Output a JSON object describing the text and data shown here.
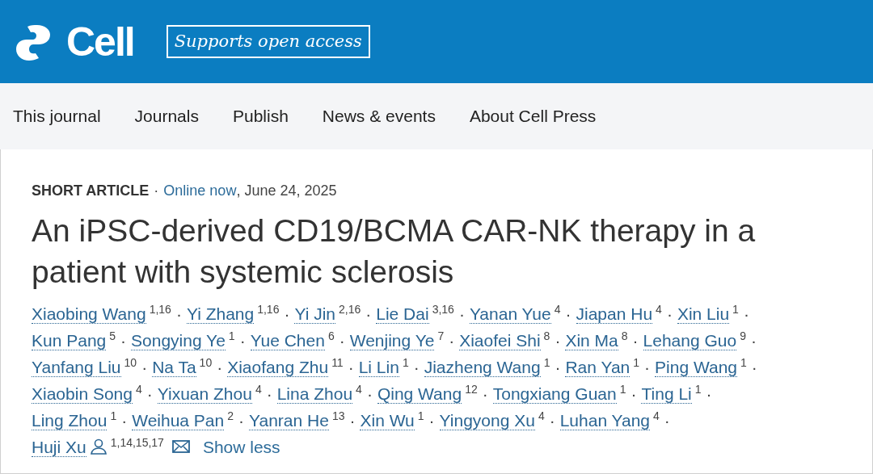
{
  "header": {
    "logo_text": "Cell",
    "badge": "Supports open access"
  },
  "nav": [
    "This journal",
    "Journals",
    "Publish",
    "News & events",
    "About Cell Press"
  ],
  "article": {
    "type": "SHORT ARTICLE",
    "meta_sep": "·",
    "status_link": "Online now",
    "date": ", June 24, 2025",
    "title": "An iPSC-derived CD19/BCMA CAR-NK therapy in a patient with systemic sclerosis",
    "author_lines": [
      [
        {
          "name": "Xiaobing Wang",
          "aff": "1,16",
          "sep": "·"
        },
        {
          "name": "Yi Zhang",
          "aff": "1,16",
          "sep": "·"
        },
        {
          "name": "Yi Jin",
          "aff": "2,16",
          "sep": "·"
        },
        {
          "name": "Lie Dai",
          "aff": "3,16",
          "sep": "·"
        },
        {
          "name": "Yanan Yue",
          "aff": "4",
          "sep": "·"
        },
        {
          "name": "Jiapan Hu",
          "aff": "4",
          "sep": "·"
        },
        {
          "name": "Xin Liu",
          "aff": "1",
          "sep": "·"
        }
      ],
      [
        {
          "name": "Kun Pang",
          "aff": "5",
          "sep": "·"
        },
        {
          "name": "Songying Ye",
          "aff": "1",
          "sep": "·"
        },
        {
          "name": "Yue Chen",
          "aff": "6",
          "sep": "·"
        },
        {
          "name": "Wenjing Ye",
          "aff": "7",
          "sep": "·"
        },
        {
          "name": "Xiaofei Shi",
          "aff": "8",
          "sep": "·"
        },
        {
          "name": "Xin Ma",
          "aff": "8",
          "sep": "·"
        },
        {
          "name": "Lehang Guo",
          "aff": "9",
          "sep": "·"
        }
      ],
      [
        {
          "name": "Yanfang Liu",
          "aff": "10",
          "sep": "·"
        },
        {
          "name": "Na Ta",
          "aff": "10",
          "sep": "·"
        },
        {
          "name": "Xiaofang Zhu",
          "aff": "11",
          "sep": "·"
        },
        {
          "name": "Li Lin",
          "aff": "1",
          "sep": "·"
        },
        {
          "name": "Jiazheng Wang",
          "aff": "1",
          "sep": "·"
        },
        {
          "name": "Ran Yan",
          "aff": "1",
          "sep": "·"
        },
        {
          "name": "Ping Wang",
          "aff": "1",
          "sep": "·"
        }
      ],
      [
        {
          "name": "Xiaobin Song",
          "aff": "4",
          "sep": "·"
        },
        {
          "name": "Yixuan Zhou",
          "aff": "4",
          "sep": "·"
        },
        {
          "name": "Lina Zhou",
          "aff": "4",
          "sep": "·"
        },
        {
          "name": "Qing Wang",
          "aff": "12",
          "sep": "·"
        },
        {
          "name": "Tongxiang Guan",
          "aff": "1",
          "sep": "·"
        },
        {
          "name": "Ting Li",
          "aff": "1",
          "sep": "·"
        }
      ],
      [
        {
          "name": "Ling Zhou",
          "aff": "1",
          "sep": "·"
        },
        {
          "name": "Weihua Pan",
          "aff": "2",
          "sep": "·"
        },
        {
          "name": "Yanran He",
          "aff": "13",
          "sep": "·"
        },
        {
          "name": "Xin Wu",
          "aff": "1",
          "sep": "·"
        },
        {
          "name": "Yingyong Xu",
          "aff": "4",
          "sep": "·"
        },
        {
          "name": "Luhan Yang",
          "aff": "4",
          "sep": "·"
        }
      ],
      [
        {
          "name": "Huji Xu",
          "aff": "1,14,15,17",
          "corresponding": true,
          "email": true
        }
      ]
    ],
    "toggle": "Show less"
  }
}
